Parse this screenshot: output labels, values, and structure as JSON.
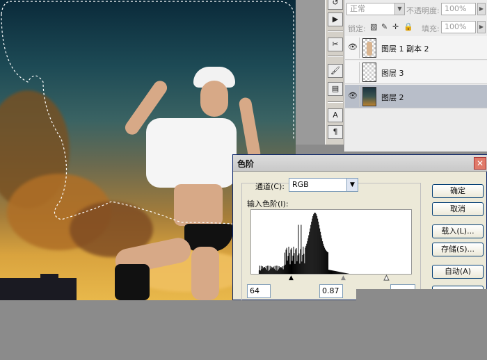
{
  "layers_panel": {
    "blend_mode": "正常",
    "opacity_label": "不透明度:",
    "opacity_value": "100%",
    "lock_label": "锁定:",
    "fill_label": "填充:",
    "fill_value": "100%",
    "layers": [
      {
        "name": "图层 1 副本 2",
        "thumb": "figure",
        "visible": true,
        "active": false
      },
      {
        "name": "图层 3",
        "thumb": "checker",
        "visible": false,
        "active": false
      },
      {
        "name": "图层 2",
        "thumb": "dark",
        "visible": true,
        "active": true
      }
    ]
  },
  "levels_dialog": {
    "title": "色阶",
    "channel_label": "通道(C):",
    "channel_value": "RGB",
    "input_levels_label": "输入色阶(I):",
    "input_black": "64",
    "input_gamma": "0.87",
    "buttons": {
      "ok": "确定",
      "cancel": "取消",
      "load": "载入(L)...",
      "save": "存储(S)...",
      "auto": "自动(A)"
    }
  },
  "colors": {
    "dialog_bg": "#ece9d8",
    "active_layer": "#b8bec9",
    "close_button": "#e07a6a"
  }
}
